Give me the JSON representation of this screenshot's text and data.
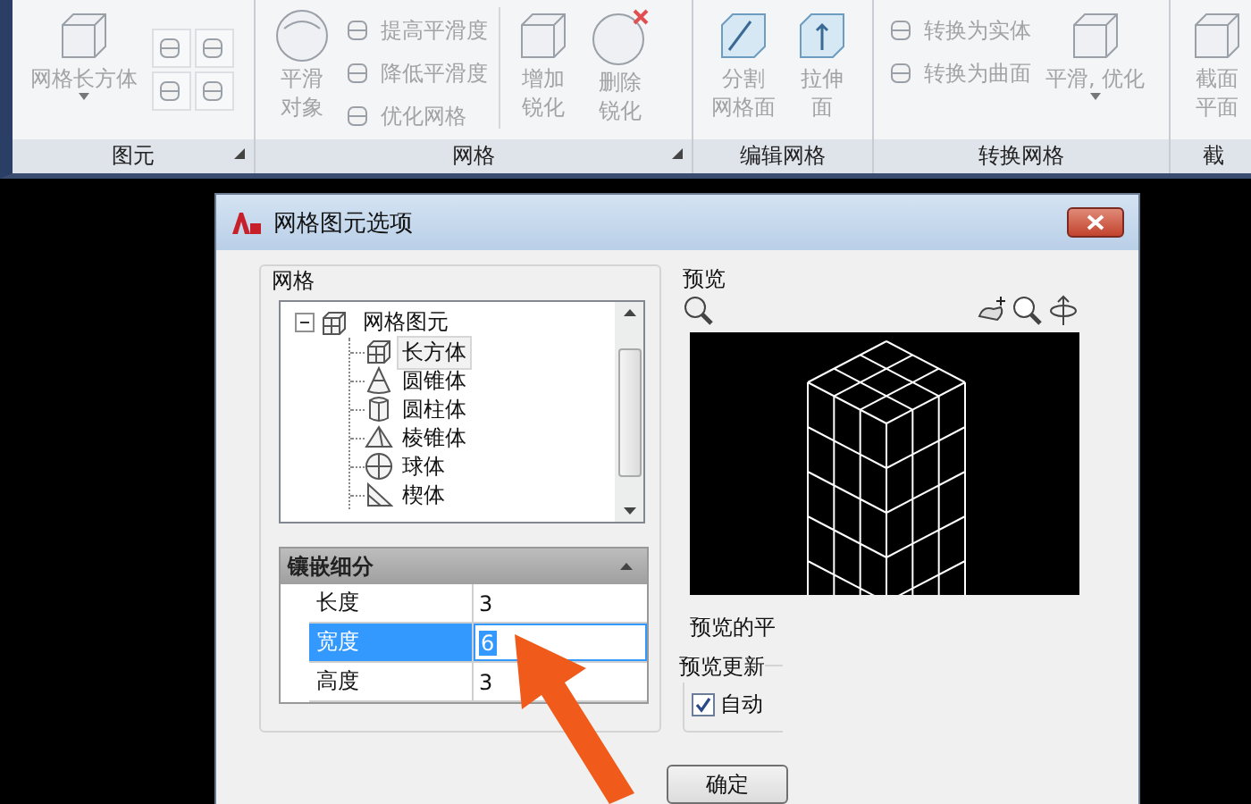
{
  "ribbon": {
    "panels": [
      {
        "title": "图元",
        "launcher": true,
        "tools": [
          {
            "kind": "large",
            "lines": [
              "网格长方体"
            ],
            "dropdown": true,
            "disabled": true
          },
          {
            "kind": "icon_grid"
          }
        ]
      },
      {
        "title": "网格",
        "launcher": true,
        "tools": [
          {
            "kind": "large",
            "lines": [
              "平滑",
              "对象"
            ],
            "dropdown": false,
            "disabled": true
          },
          {
            "kind": "stack",
            "items": [
              {
                "label": "提高平滑度",
                "disabled": true
              },
              {
                "label": "降低平滑度",
                "disabled": true
              },
              {
                "label": "优化网格",
                "disabled": true
              }
            ]
          },
          {
            "kind": "separator"
          },
          {
            "kind": "large",
            "lines": [
              "增加",
              "锐化"
            ],
            "dropdown": false,
            "disabled": true
          },
          {
            "kind": "large",
            "lines": [
              "删除",
              "锐化"
            ],
            "dropdown": false,
            "disabled": true
          }
        ]
      },
      {
        "title": "编辑网格",
        "launcher": false,
        "tools": [
          {
            "kind": "large",
            "lines": [
              "分割",
              "网格面"
            ],
            "dropdown": false,
            "disabled": true
          },
          {
            "kind": "large",
            "lines": [
              "拉伸",
              "面"
            ],
            "dropdown": false,
            "disabled": true
          }
        ]
      },
      {
        "title": "转换网格",
        "launcher": false,
        "tools": [
          {
            "kind": "stack",
            "items": [
              {
                "label": "转换为实体",
                "disabled": true
              },
              {
                "label": "转换为曲面",
                "disabled": true
              }
            ]
          },
          {
            "kind": "large",
            "lines": [
              "平滑, 优化"
            ],
            "dropdown": true,
            "disabled": true
          }
        ]
      },
      {
        "title": "截",
        "launcher": false,
        "tools": [
          {
            "kind": "large",
            "lines": [
              "截面",
              "平面"
            ],
            "dropdown": false,
            "disabled": true
          }
        ]
      }
    ]
  },
  "dialog": {
    "title": "网格图元选项",
    "mesh_group": {
      "label": "网格",
      "tree": {
        "label": "网格图元",
        "expanded": true,
        "children": [
          {
            "label": "长方体",
            "selected": true
          },
          {
            "label": "圆锥体",
            "selected": false
          },
          {
            "label": "圆柱体",
            "selected": false
          },
          {
            "label": "棱锥体",
            "selected": false
          },
          {
            "label": "球体",
            "selected": false
          },
          {
            "label": "楔体",
            "selected": false
          }
        ]
      },
      "tessellation": {
        "title": "镶嵌细分",
        "expanded": true,
        "rows": [
          {
            "label": "长度",
            "value": "3",
            "selected": false
          },
          {
            "label": "宽度",
            "value": "6",
            "selected": true
          },
          {
            "label": "高度",
            "value": "3",
            "selected": false
          }
        ]
      }
    },
    "preview": {
      "label": "预览",
      "caption": "预览的平"
    },
    "update_group": {
      "label": "预览更新",
      "checkbox": {
        "label": "自动",
        "checked": true
      }
    },
    "buttons": [
      "确定"
    ]
  }
}
